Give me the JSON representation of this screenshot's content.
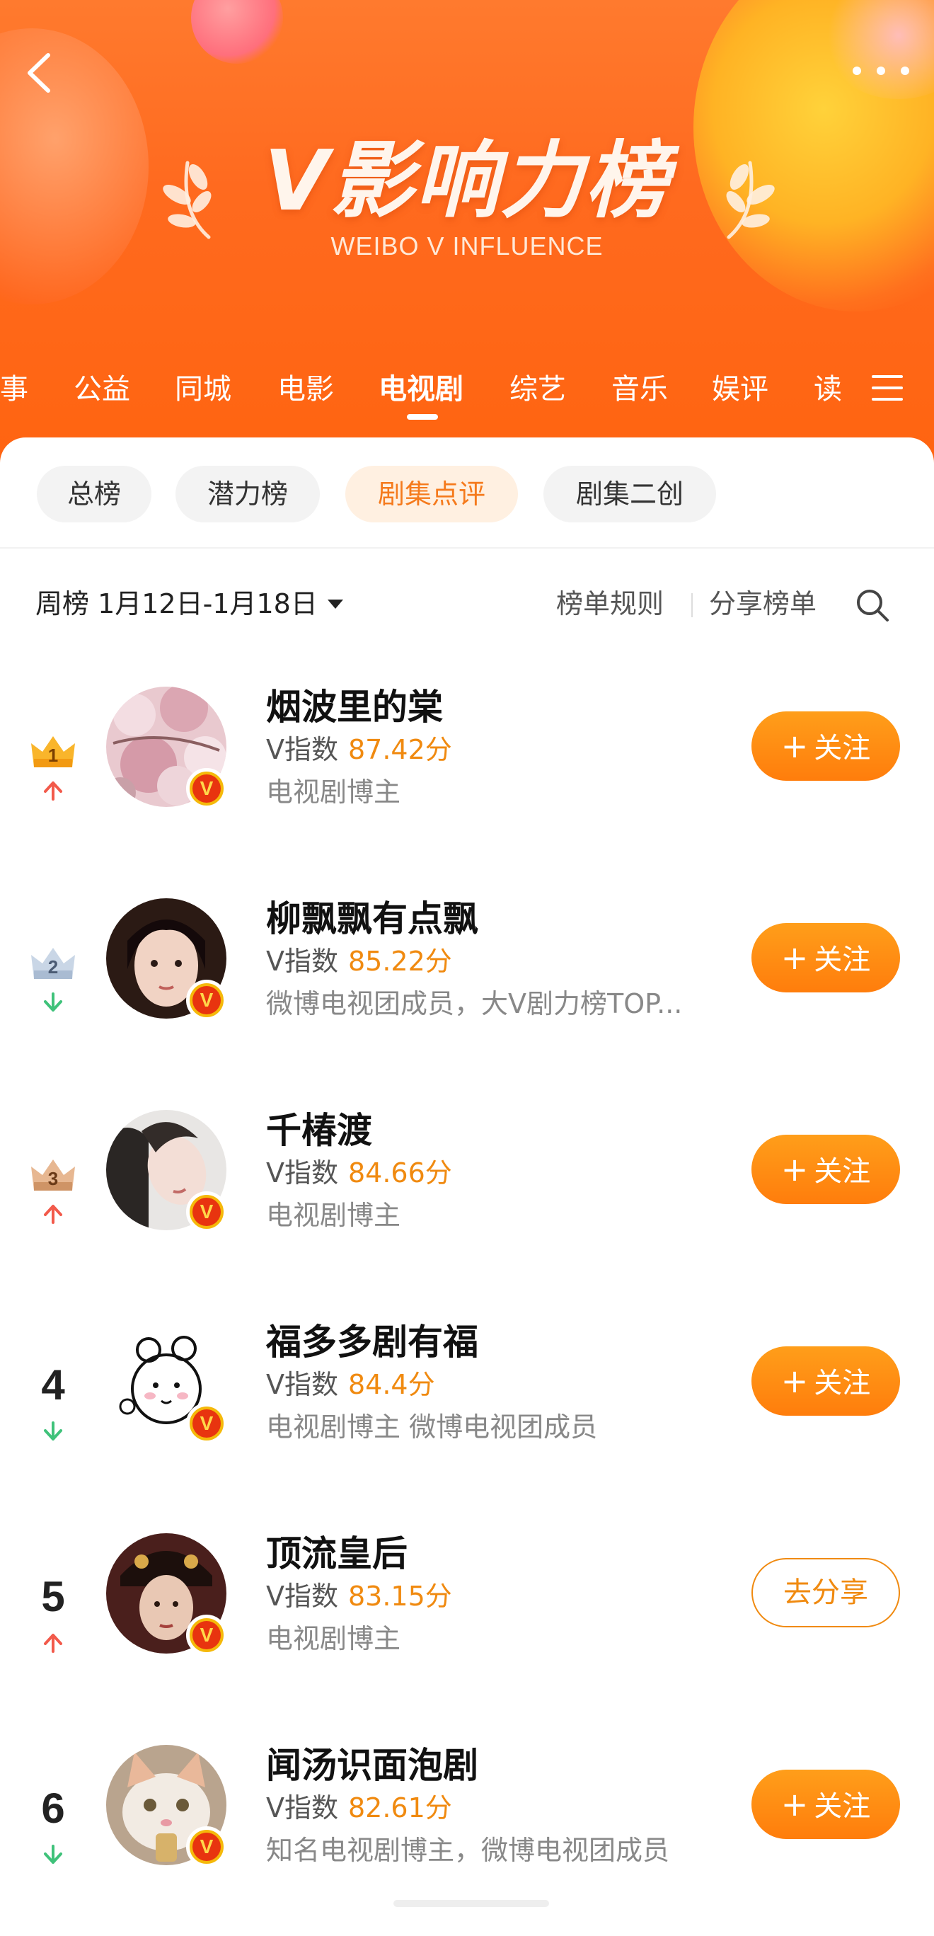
{
  "header": {
    "title": "V影响力榜",
    "subtitle": "WEIBO V INFLUENCE"
  },
  "category_tabs": [
    {
      "label": "事",
      "active": false
    },
    {
      "label": "公益",
      "active": false
    },
    {
      "label": "同城",
      "active": false
    },
    {
      "label": "电影",
      "active": false
    },
    {
      "label": "电视剧",
      "active": true
    },
    {
      "label": "综艺",
      "active": false
    },
    {
      "label": "音乐",
      "active": false
    },
    {
      "label": "娱评",
      "active": false
    },
    {
      "label": "读",
      "active": false
    }
  ],
  "sub_tabs": [
    {
      "label": "总榜",
      "active": false
    },
    {
      "label": "潜力榜",
      "active": false
    },
    {
      "label": "剧集点评",
      "active": true
    },
    {
      "label": "剧集二创",
      "active": false
    }
  ],
  "filter": {
    "period": "周榜 1月12日-1月18日",
    "rules": "榜单规则",
    "share": "分享榜单"
  },
  "score_label": "V指数",
  "actions": {
    "follow": "关注",
    "share": "去分享"
  },
  "colors": {
    "accent": "#ff7d0c",
    "up": "#f25a4b",
    "down": "#3fc27a",
    "score": "#f08a10"
  },
  "ranking": [
    {
      "rank": "1",
      "name": "烟波里的棠",
      "score": "87.42分",
      "desc": "电视剧博主",
      "trend": "up",
      "action": "follow",
      "crown": "gold"
    },
    {
      "rank": "2",
      "name": "柳飘飘有点飘",
      "score": "85.22分",
      "desc": "微博电视团成员，大V剧力榜TOP...",
      "trend": "down",
      "action": "follow",
      "crown": "silver"
    },
    {
      "rank": "3",
      "name": "千椿渡",
      "score": "84.66分",
      "desc": "电视剧博主",
      "trend": "up",
      "action": "follow",
      "crown": "bronze"
    },
    {
      "rank": "4",
      "name": "福多多剧有福",
      "score": "84.4分",
      "desc": "电视剧博主 微博电视团成员",
      "trend": "down",
      "action": "follow",
      "crown": ""
    },
    {
      "rank": "5",
      "name": "顶流皇后",
      "score": "83.15分",
      "desc": "电视剧博主",
      "trend": "up",
      "action": "share",
      "crown": ""
    },
    {
      "rank": "6",
      "name": "闻汤识面泡剧",
      "score": "82.61分",
      "desc": "知名电视剧博主，微博电视团成员",
      "trend": "down",
      "action": "follow",
      "crown": ""
    }
  ]
}
